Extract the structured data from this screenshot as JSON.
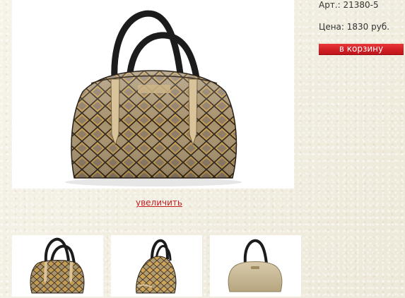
{
  "product": {
    "article": "Арт.: 21380-5",
    "price": "Цена: 1830 руб.",
    "cart_label": "в корзину",
    "zoom_label": "увеличить"
  },
  "images": {
    "main_photo": "handbag-snake-print-photo",
    "thumbnails": [
      "handbag-front-thumb",
      "handbag-side-thumb",
      "handbag-back-thumb"
    ]
  },
  "colors": {
    "cart_button": "#d11f24",
    "link": "#c21f1f",
    "background": "#f3efe2"
  }
}
